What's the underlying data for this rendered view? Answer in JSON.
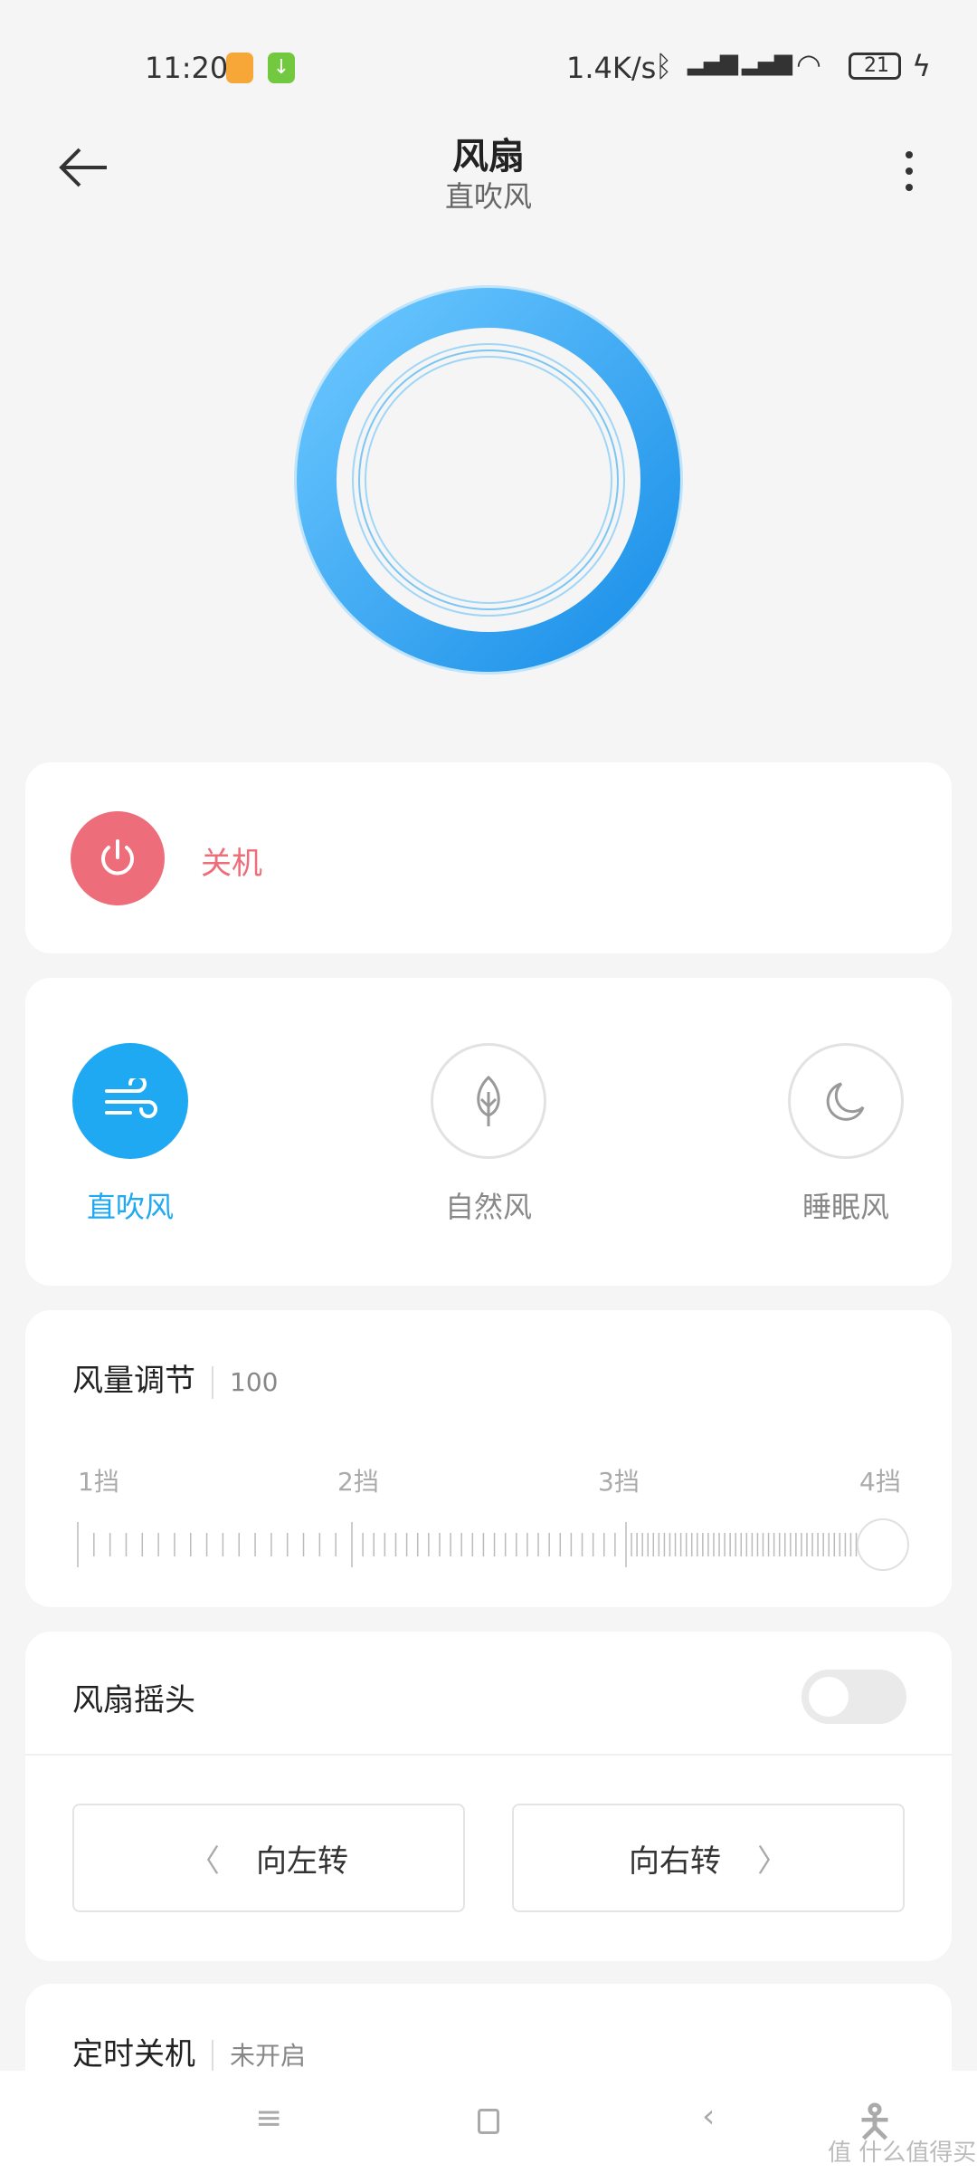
{
  "status_bar": {
    "time": "11:20",
    "network_speed": "1.4K/s",
    "battery": "21",
    "icons": [
      "notification-orange-icon",
      "download-icon",
      "bluetooth-icon",
      "signal-hd-icon",
      "signal-hd-icon",
      "wifi-icon",
      "battery-icon",
      "charging-icon"
    ]
  },
  "header": {
    "title": "风扇",
    "subtitle": "直吹风",
    "back_icon": "arrow-left-icon",
    "more_icon": "more-vertical-icon"
  },
  "power": {
    "label": "关机",
    "color": "#ee6d7a"
  },
  "modes": [
    {
      "label": "直吹风",
      "icon": "wind-icon",
      "active": true
    },
    {
      "label": "自然风",
      "icon": "leaf-icon",
      "active": false
    },
    {
      "label": "睡眠风",
      "icon": "moon-icon",
      "active": false
    }
  ],
  "accent": "#1ea9f2",
  "speed": {
    "title": "风量调节",
    "value": "100",
    "levels": [
      "1挡",
      "2挡",
      "3挡",
      "4挡"
    ],
    "percent": 100
  },
  "oscillation": {
    "title": "风扇摇头",
    "enabled": false,
    "left_label": "向左转",
    "right_label": "向右转"
  },
  "timer": {
    "title": "定时关机",
    "value": "未开启"
  },
  "nav": {
    "icons": [
      "menu-icon",
      "home-icon",
      "back-icon",
      "accessibility-icon"
    ]
  },
  "watermark": "值 什么值得买"
}
